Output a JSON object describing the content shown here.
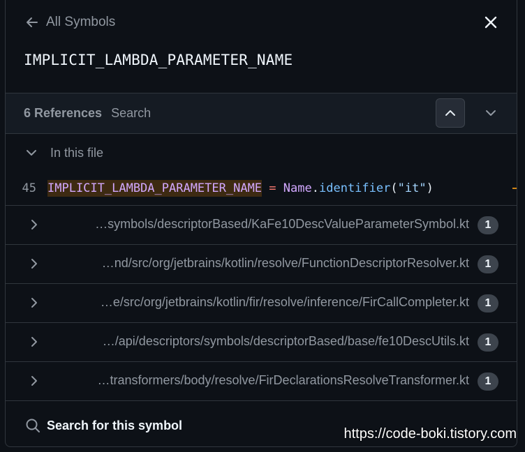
{
  "header": {
    "back_label": "All Symbols",
    "symbol_name": "IMPLICIT_LAMBDA_PARAMETER_NAME"
  },
  "references": {
    "count_label": "6 References",
    "search_placeholder": "Search"
  },
  "in_file": {
    "label": "In this file",
    "line_number": "45",
    "code": {
      "symbol": "IMPLICIT_LAMBDA_PARAMETER_NAME",
      "op": "=",
      "type": "Name",
      "dot": ".",
      "fn": "identifier",
      "open": "(",
      "str": "\"it\"",
      "close": ")"
    }
  },
  "files": [
    {
      "path": "…symbols/descriptorBased/KaFe10DescValueParameterSymbol.kt",
      "count": "1"
    },
    {
      "path": "…nd/src/org/jetbrains/kotlin/resolve/FunctionDescriptorResolver.kt",
      "count": "1"
    },
    {
      "path": "…e/src/org/jetbrains/kotlin/fir/resolve/inference/FirCallCompleter.kt",
      "count": "1"
    },
    {
      "path": "…/api/descriptors/symbols/descriptorBased/base/fe10DescUtils.kt",
      "count": "1"
    },
    {
      "path": "…transformers/body/resolve/FirDeclarationsResolveTransformer.kt",
      "count": "1"
    }
  ],
  "footer": {
    "search_label": "Search for this symbol"
  },
  "watermark": "https://code-boki.tistory.com",
  "icons": {
    "back": "arrow-left-icon",
    "close": "x-icon",
    "up": "chevron-up-icon",
    "down": "chevron-down-icon",
    "row": "chevron-right-icon",
    "search": "search-icon"
  },
  "colors": {
    "background": "#0d1117",
    "refbar_bg": "#151b23",
    "border": "#30363d",
    "muted_text": "#9198a1",
    "symbol_highlight": "#3d2a12",
    "keyword_purple": "#d2a8ff",
    "operator_red": "#ff7b72",
    "function_blue": "#79c0ff",
    "string_blue": "#a5d6ff",
    "badge_bg": "#3d444d",
    "marker_orange": "#d18616"
  }
}
